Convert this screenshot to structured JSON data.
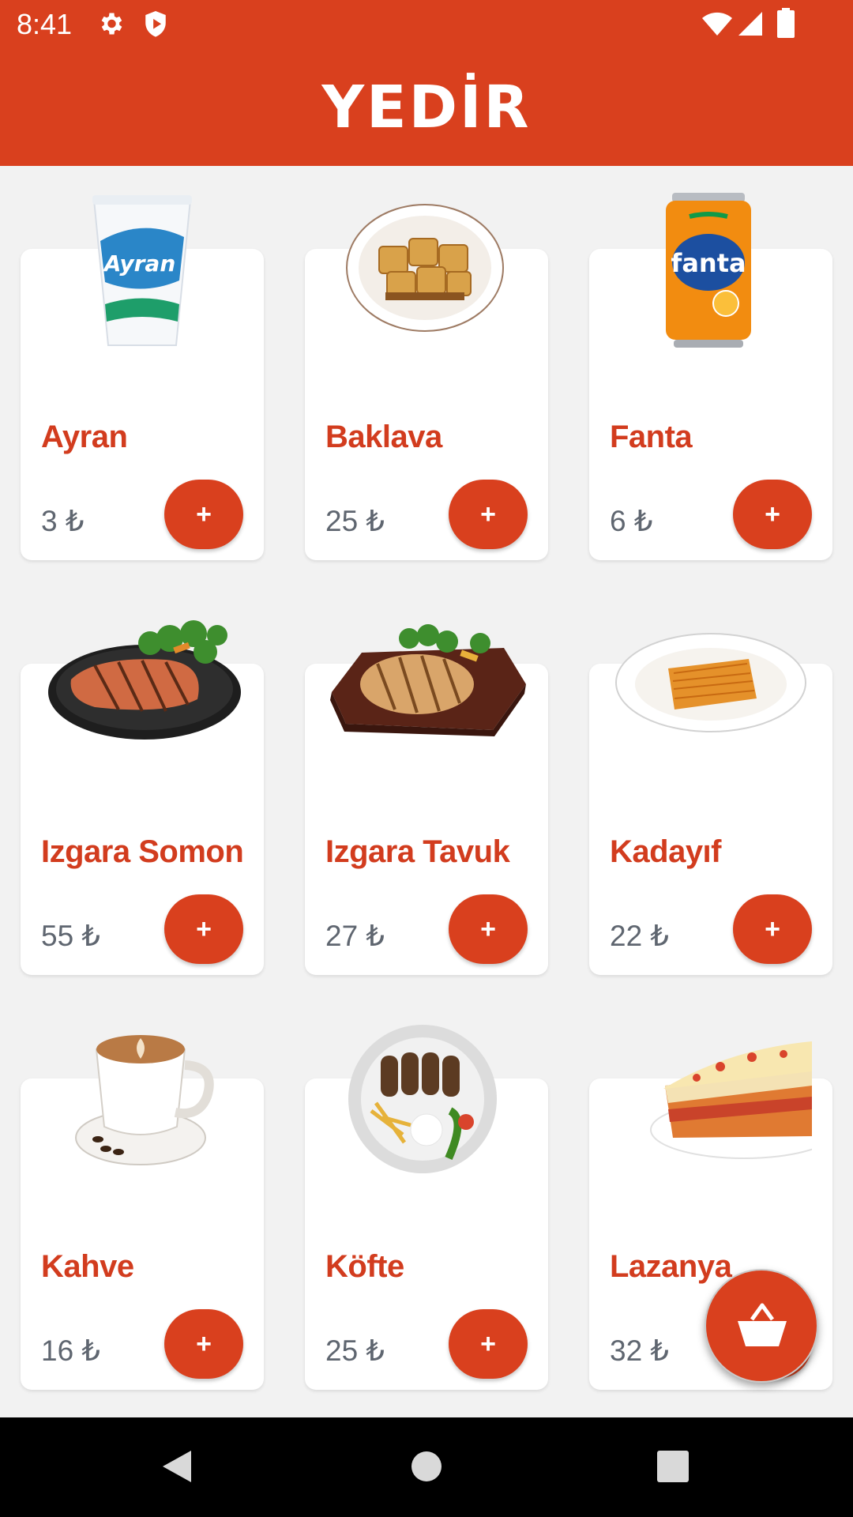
{
  "status_bar": {
    "time": "8:41",
    "icons": [
      "settings-icon",
      "shield-icon",
      "wifi-icon",
      "signal-icon",
      "battery-icon"
    ]
  },
  "app_bar": {
    "title": "YEDİR"
  },
  "colors": {
    "brand": "#D9401E",
    "product_name": "#D23C1E",
    "price": "#5F6670",
    "background": "#F2F2F2",
    "card": "#FFFFFF"
  },
  "products": [
    {
      "name": "Ayran",
      "price": "3 ₺",
      "add_label": "+",
      "image": "ayran-cup-image"
    },
    {
      "name": "Baklava",
      "price": "25 ₺",
      "add_label": "+",
      "image": "baklava-plate-image"
    },
    {
      "name": "Fanta",
      "price": "6 ₺",
      "add_label": "+",
      "image": "fanta-can-image"
    },
    {
      "name": "Izgara Somon",
      "price": "55 ₺",
      "add_label": "+",
      "image": "grilled-salmon-image"
    },
    {
      "name": "Izgara Tavuk",
      "price": "27 ₺",
      "add_label": "+",
      "image": "grilled-chicken-image"
    },
    {
      "name": "Kadayıf",
      "price": "22 ₺",
      "add_label": "+",
      "image": "kadayif-plate-image"
    },
    {
      "name": "Kahve",
      "price": "16 ₺",
      "add_label": "+",
      "image": "coffee-cup-image"
    },
    {
      "name": "Köfte",
      "price": "25 ₺",
      "add_label": "+",
      "image": "kofte-plate-image"
    },
    {
      "name": "Lazanya",
      "price": "32 ₺",
      "add_label": "+",
      "image": "lasagna-image"
    }
  ],
  "fab": {
    "icon": "basket-icon"
  },
  "nav_bar": {
    "icons": [
      "back-icon",
      "home-icon",
      "recents-icon"
    ]
  }
}
